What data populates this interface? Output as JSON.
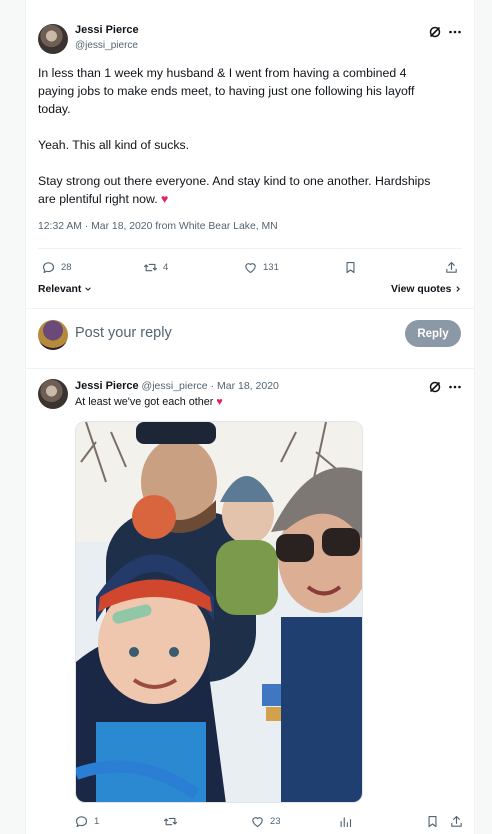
{
  "main_tweet": {
    "author_name": "Jessi Pierce",
    "author_handle": "@jessi_pierce",
    "paragraphs": [
      "In less than 1 week my husband & I went from having a combined 4 paying jobs to make ends meet, to having just one following his layoff today.",
      "Yeah. This all kind of sucks.",
      "Stay strong out there everyone. And stay kind to one another. Hardships are plentiful right now."
    ],
    "heart_emoji": "♥",
    "timestamp": "12:32 AM · Mar 18, 2020 from White Bear Lake, MN",
    "replies": "28",
    "reposts": "4",
    "likes": "131"
  },
  "sort_label": "Relevant",
  "view_quotes_label": "View quotes",
  "reply_composer": {
    "placeholder": "Post your reply",
    "button_label": "Reply"
  },
  "reply_tweet": {
    "author_name": "Jessi Pierce",
    "author_handle": "@jessi_pierce",
    "date": "Mar 18, 2020",
    "text": "At least we've got each other",
    "heart_emoji": "♥",
    "replies": "1",
    "likes": "23"
  },
  "icons": {
    "grok": "grok-icon",
    "more": "more-icon",
    "reply": "reply-icon",
    "repost": "repost-icon",
    "like": "like-icon",
    "bookmark": "bookmark-icon",
    "share": "share-icon",
    "views": "views-icon"
  },
  "colors": {
    "text_primary": "#0f1419",
    "text_secondary": "#536471",
    "reply_button": "#8b98a5",
    "heart": "#e0245e"
  }
}
